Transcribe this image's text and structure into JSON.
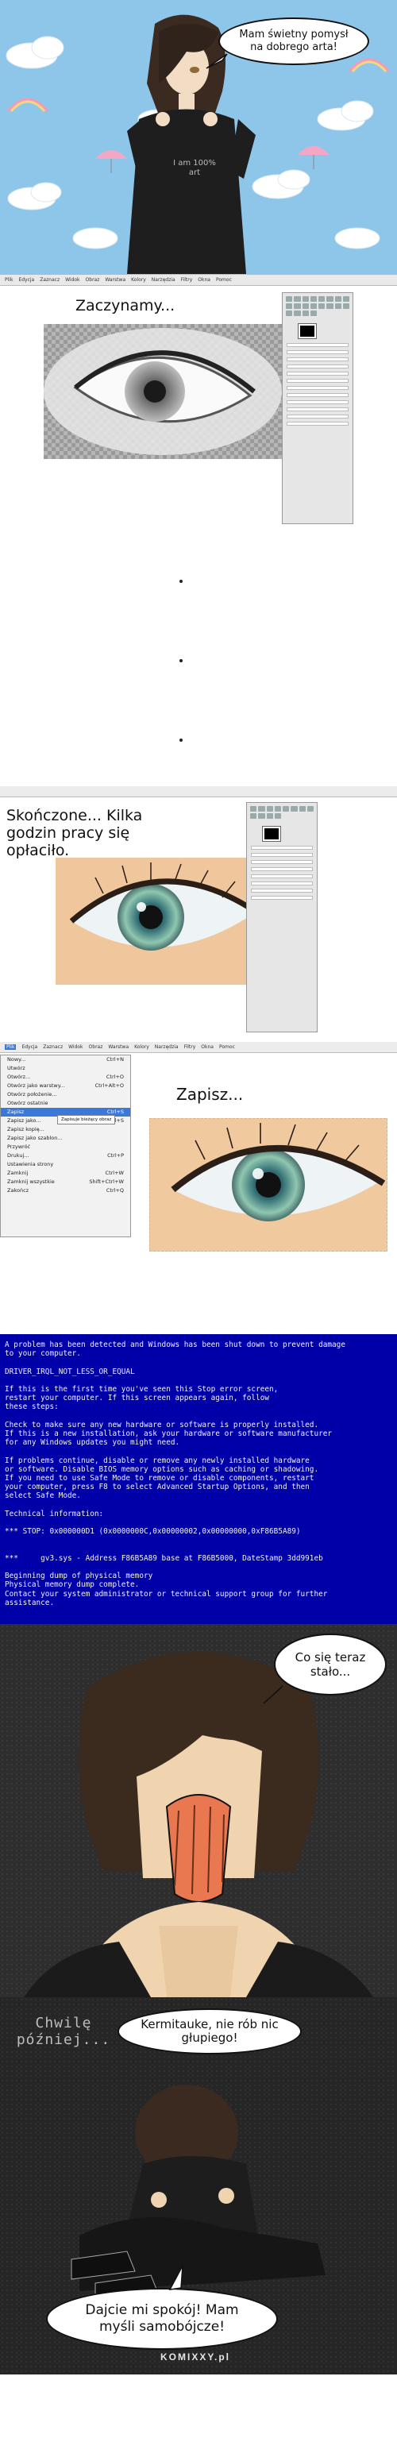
{
  "panel1": {
    "speech": "Mam świetny pomysł na dobrego arta!",
    "shirt_text": "I am 100% art",
    "menu": [
      "Plik",
      "Edycja",
      "Zaznacz",
      "Widok",
      "Obraz",
      "Warstwa",
      "Kolory",
      "Narzędzia",
      "Filtry",
      "Okna",
      "Pomoc"
    ]
  },
  "panel2": {
    "caption": "Zaczynamy..."
  },
  "dots": [
    "•",
    "•",
    "•"
  ],
  "panel3": {
    "caption": "Skończone... Kilka godzin pracy się opłaciło."
  },
  "panel4": {
    "caption": "Zapisz...",
    "menu": [
      "Plik",
      "Edycja",
      "Zaznacz",
      "Widok",
      "Obraz",
      "Warstwa",
      "Kolory",
      "Narzędzia",
      "Filtry",
      "Okna",
      "Pomoc"
    ],
    "file_items": [
      {
        "label": "Nowy...",
        "shortcut": "Ctrl+N"
      },
      {
        "label": "Utwórz",
        "shortcut": ""
      },
      {
        "label": "Otwórz...",
        "shortcut": "Ctrl+O"
      },
      {
        "label": "Otwórz jako warstwy...",
        "shortcut": "Ctrl+Alt+O"
      },
      {
        "label": "Otwórz położenie...",
        "shortcut": ""
      },
      {
        "label": "Otwórz ostatnie",
        "shortcut": ""
      },
      {
        "label": "Zapisz",
        "shortcut": "Ctrl+S"
      },
      {
        "label": "Zapisz jako...",
        "shortcut": "Shift+Ctrl+S"
      },
      {
        "label": "Zapisz kopię...",
        "shortcut": ""
      },
      {
        "label": "Zapisz jako szablon...",
        "shortcut": ""
      },
      {
        "label": "Przywróć",
        "shortcut": ""
      },
      {
        "label": "Drukuj...",
        "shortcut": "Ctrl+P"
      },
      {
        "label": "Ustawienia strony",
        "shortcut": ""
      },
      {
        "label": "Zamknij",
        "shortcut": "Ctrl+W"
      },
      {
        "label": "Zamknij wszystkie",
        "shortcut": "Shift+Ctrl+W"
      },
      {
        "label": "Zakończ",
        "shortcut": "Ctrl+Q"
      }
    ],
    "tooltip": "Zapisuje bieżący obraz"
  },
  "bsod": {
    "text": "A problem has been detected and Windows has been shut down to prevent damage\nto your computer.\n\nDRIVER_IRQL_NOT_LESS_OR_EQUAL\n\nIf this is the first time you've seen this Stop error screen,\nrestart your computer. If this screen appears again, follow\nthese steps:\n\nCheck to make sure any new hardware or software is properly installed.\nIf this is a new installation, ask your hardware or software manufacturer\nfor any Windows updates you might need.\n\nIf problems continue, disable or remove any newly installed hardware\nor software. Disable BIOS memory options such as caching or shadowing.\nIf you need to use Safe Mode to remove or disable components, restart\nyour computer, press F8 to select Advanced Startup Options, and then\nselect Safe Mode.\n\nTechnical information:\n\n*** STOP: 0x000000D1 (0x0000000C,0x00000002,0x00000000,0xF86B5A89)\n\n\n***     gv3.sys - Address F86B5A89 base at F86B5000, DateStamp 3dd991eb\n\nBeginning dump of physical memory\nPhysical memory dump complete.\nContact your system administrator or technical support group for further\nassistance."
  },
  "panel6": {
    "speech": "Co się teraz stało..."
  },
  "panel7": {
    "narration": "Chwilę później...",
    "speech_top": "Kermitauke, nie rób nic głupiego!",
    "speech_bottom": "Dajcie mi spokój! Mam myśli samobójcze!",
    "watermark": "KOMIXXY.pl"
  },
  "colors": {
    "sky": "#8ec6ea",
    "bsod_blue": "#0000a8",
    "iris": "#4f9aa6",
    "skin": "#f3cba0",
    "dark": "#262626"
  }
}
